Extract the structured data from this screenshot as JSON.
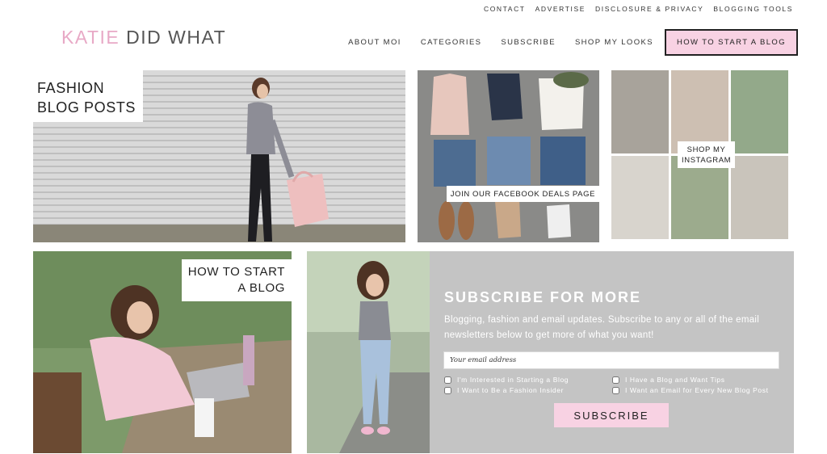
{
  "utility_nav": {
    "items": [
      "CONTACT",
      "ADVERTISE",
      "DISCLOSURE & PRIVACY",
      "BLOGGING TOOLS"
    ]
  },
  "logo": {
    "part1": "KATIE",
    "part2": "DID WHAT"
  },
  "main_nav": {
    "items": [
      "ABOUT MOI",
      "CATEGORIES",
      "SUBSCRIBE",
      "SHOP MY LOOKS"
    ],
    "cta": "HOW TO START A BLOG"
  },
  "tiles": {
    "fashion": {
      "label_line1": "FASHION",
      "label_line2": "BLOG POSTS"
    },
    "facebook": {
      "label": "JOIN OUR FACEBOOK DEALS PAGE"
    },
    "instagram": {
      "label_line1": "SHOP MY",
      "label_line2": "INSTAGRAM"
    },
    "blog": {
      "label_line1": "HOW TO START",
      "label_line2": "A BLOG"
    }
  },
  "subscribe": {
    "title": "SUBSCRIBE FOR MORE",
    "description": "Blogging, fashion and email updates. Subscribe to any or all of the email newsletters below to get more of what you want!",
    "email_placeholder": "Your email address",
    "options": [
      "I'm Interested in Starting a Blog",
      "I Have a Blog and Want Tips",
      "I Want to Be a Fashion Insider",
      "I Want an Email for Every New Blog Post"
    ],
    "button": "SUBSCRIBE"
  },
  "colors": {
    "accent_pink": "#f8d2e3",
    "logo_pink": "#e8a9c6",
    "panel_gray": "#c4c4c4"
  }
}
